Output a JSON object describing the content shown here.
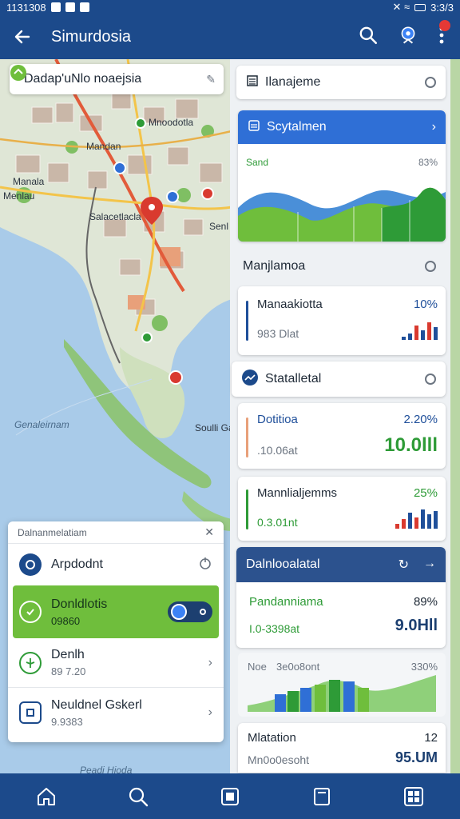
{
  "status_bar": {
    "left_text": "1131308",
    "right_text": "3:3/3"
  },
  "app_bar": {
    "title": "Simurdosia"
  },
  "map": {
    "search_text": "Dadap'uNlo noaejsia",
    "labels": [
      "Mnoodotla",
      "Mandan",
      "Manala",
      "Menlau",
      "Salacetlacla",
      "Senl",
      "Genaleirnam",
      "Soulli Gatel",
      "Peadi Hioda"
    ]
  },
  "left_card": {
    "header": "Dalnanmelatiam",
    "items": [
      {
        "title": "Arpdodnt",
        "sub": ""
      },
      {
        "title": "Donldlotis",
        "sub": "09860"
      },
      {
        "title": "Denlh",
        "sub": "89 7.20"
      },
      {
        "title": "Neuldnel Gskerl",
        "sub": "9.9383"
      }
    ]
  },
  "panel": {
    "card1": {
      "title": "Ilanajeme"
    },
    "card2": {
      "title": "Scytalmen",
      "chart_left": "Sand",
      "chart_right": "83%"
    },
    "card3": {
      "title": "Manjlamoa"
    },
    "stat1": {
      "label": "Manaakiotta",
      "pct": "10%",
      "sub": "983 Dlat"
    },
    "card4": {
      "title": "Statalletal"
    },
    "stat2": {
      "label": "Dotitioa",
      "pct": "2.20%",
      "sub": ".10.06at",
      "big": "10.0lll"
    },
    "stat3": {
      "label": "Mannlialjemms",
      "pct": "25%",
      "sub": "0.3.01nt"
    },
    "card5": {
      "title": "Dalnlooalatal"
    },
    "stat4": {
      "label": "Pandanniama",
      "pct": "89%",
      "sub": "I.0-3398at",
      "big": "9.0Hll"
    },
    "chart2": {
      "left": "Noe",
      "mid": "3e0o8ont",
      "right": "330%"
    },
    "stat5": {
      "label": "Mlatation",
      "value": "12",
      "sub": "Mn0o0esoht",
      "big": "95.UM"
    }
  },
  "colors": {
    "primary": "#1c4a8b",
    "green": "#6fbe3c",
    "blue": "#2f6fd6"
  },
  "icons": [
    "back-arrow-icon",
    "search-icon",
    "location-pin-icon",
    "more-icon",
    "home-icon",
    "search-icon",
    "square-icon",
    "document-icon",
    "grid-icon"
  ]
}
